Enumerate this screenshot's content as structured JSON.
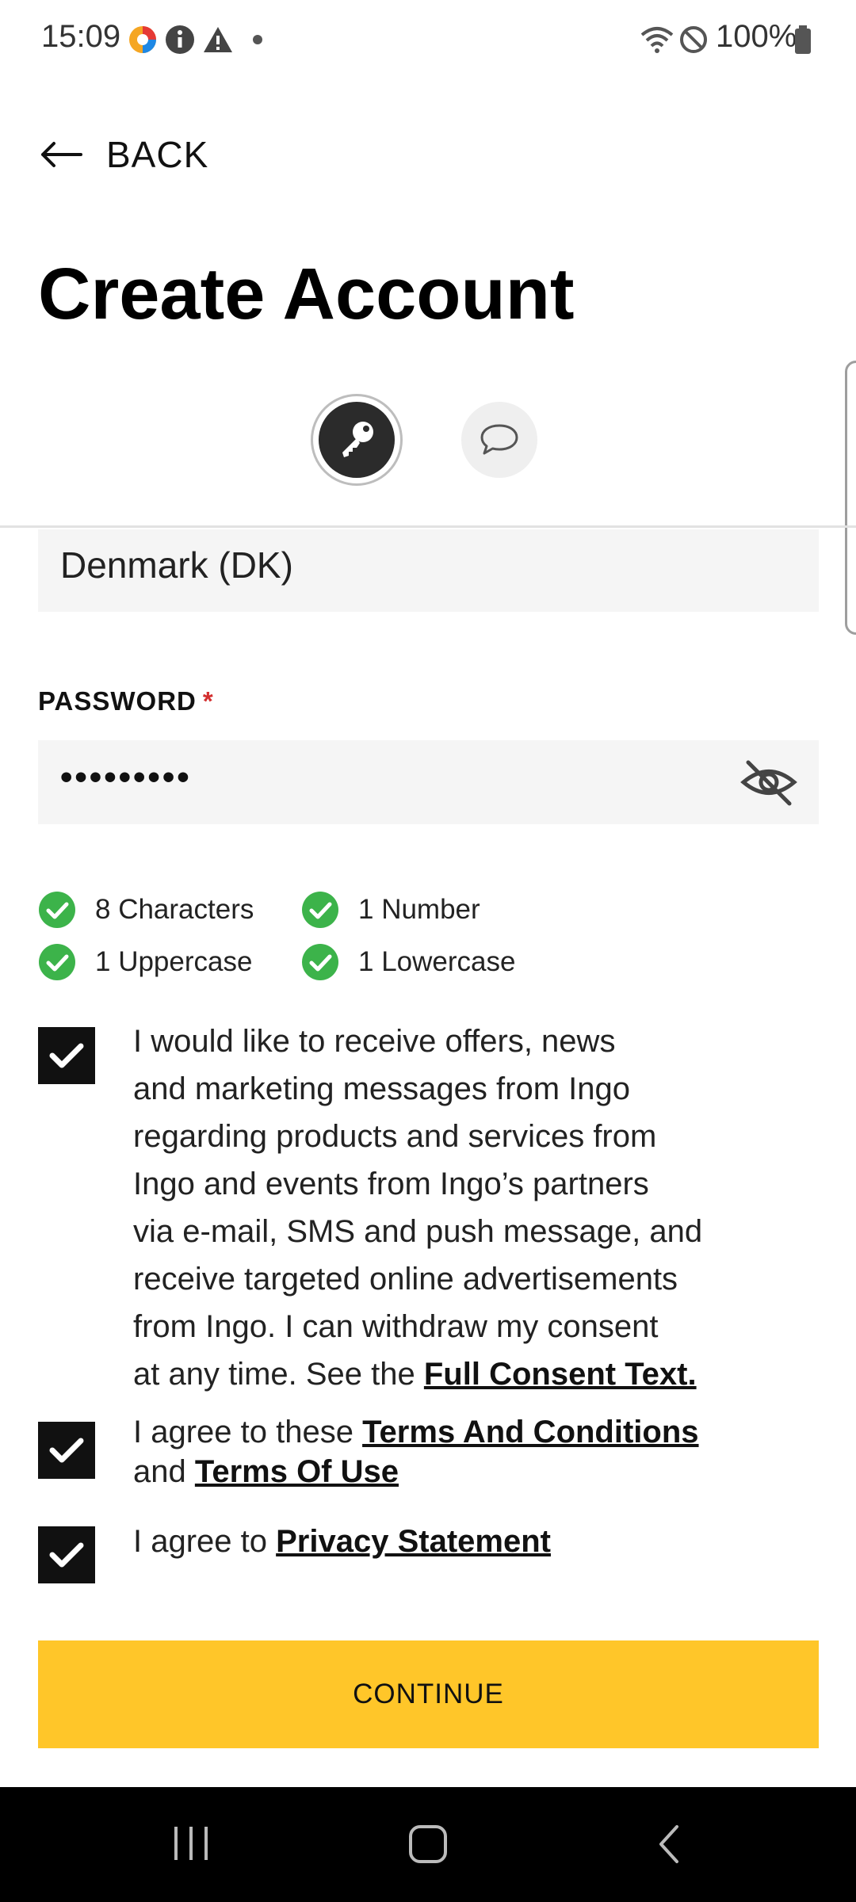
{
  "status_bar": {
    "time": "15:09",
    "battery": "100%"
  },
  "header": {
    "back_label": "BACK",
    "title": "Create Account"
  },
  "steps": [
    {
      "icon": "key-icon"
    },
    {
      "icon": "chat-bubble-icon"
    }
  ],
  "form": {
    "country_value": "Denmark (DK)",
    "password_label": "PASSWORD",
    "required_marker": "*",
    "password_value": "•••••••••",
    "requirements": [
      {
        "label": "8 Characters"
      },
      {
        "label": "1 Number"
      },
      {
        "label": "1 Uppercase"
      },
      {
        "label": "1 Lowercase"
      }
    ]
  },
  "consents": {
    "marketing": {
      "lines": [
        "I would like to receive offers, news",
        "and marketing messages from Ingo",
        "regarding products and services from",
        "Ingo and events from Ingo’s partners",
        "via e-mail, SMS and push message, and",
        "receive targeted online advertisements",
        "from Ingo. I can withdraw my consent"
      ],
      "last_line_prefix": "at any time. See the ",
      "link": "Full Consent Text."
    },
    "terms": {
      "prefix": "I agree to these ",
      "link1": "Terms And Conditions",
      "middle": "and ",
      "link2": "Terms Of Use"
    },
    "privacy": {
      "prefix": "I agree to ",
      "link": "Privacy Statement"
    }
  },
  "continue_label": "CONTINUE",
  "colors": {
    "accent": "#ffc629",
    "success": "#3cb34a",
    "required": "#d32f2f"
  }
}
